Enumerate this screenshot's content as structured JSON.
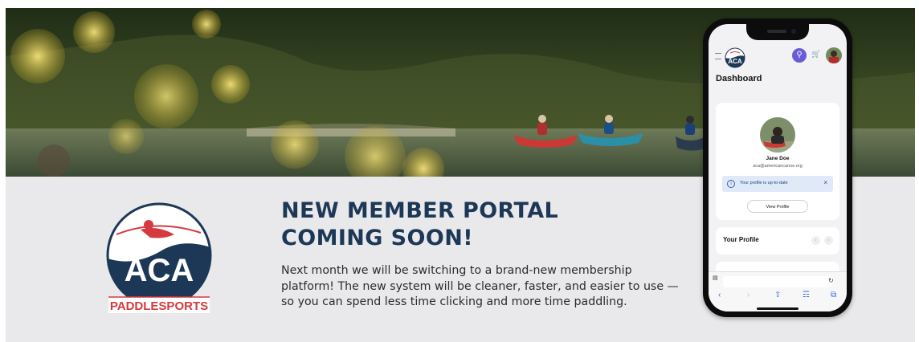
{
  "headline": {
    "line1": "NEW MEMBER PORTAL",
    "line2": "COMING SOON!"
  },
  "body": "Next month we will be switching to a brand-new membership platform! The new system will be cleaner, faster, and easier to use —so you can spend less time clicking and more time paddling.",
  "logo": {
    "letters": "ACA",
    "wordmark": "PADDLESPORTS"
  },
  "colors": {
    "navy": "#1d3857",
    "red": "#d43a3f",
    "accent_purple": "#6b5bd6",
    "banner_bg": "#e9e9eb"
  },
  "phone": {
    "page_title": "Dashboard",
    "icons": {
      "menu": "menu-icon",
      "search": "search-icon",
      "cart": "cart-icon",
      "avatar": "avatar"
    },
    "profile": {
      "name": "Jane Doe",
      "email": "aca@americancanoe.org"
    },
    "alert": {
      "text": "Your profile is up-to-date",
      "close": "×",
      "icon": "i"
    },
    "view_profile_label": "View Profile",
    "your_profile_label": "Your Profile",
    "browser": {
      "back": "‹",
      "forward": "›",
      "share": "⇧",
      "bookmarks": "🕮",
      "tabs": "⧉"
    }
  }
}
